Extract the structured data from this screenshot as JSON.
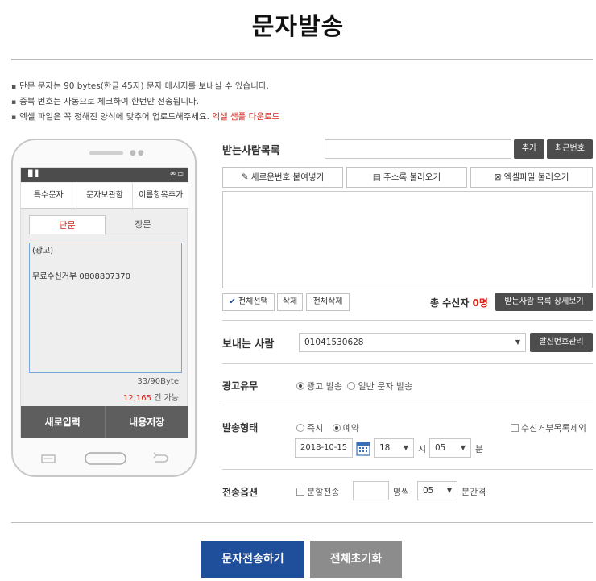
{
  "page": {
    "title": "문자발송"
  },
  "notes": [
    "단문 문자는 90 bytes(한글 45자) 문자 메시지를 보내실 수 있습니다.",
    "중복 번호는 자동으로 체크하여 한번만 전송됩니다.",
    "엑셀 파일은 꼭 정해진 양식에 맞추어 업로드해주세요."
  ],
  "excel_sample_link": "엑셀 샘플 다운로드",
  "phone": {
    "tabs": [
      "특수문자",
      "문자보관함",
      "이름항목추가"
    ],
    "subtabs": [
      "단문",
      "장문"
    ],
    "message": "(광고)\n\n무료수신거부 0808807370",
    "bytes": "33/90Byte",
    "avail_count": "12,165",
    "avail_suffix": " 건 가능",
    "btn_new": "새로입력",
    "btn_save": "내용저장"
  },
  "recipients": {
    "label": "받는사람목록",
    "input_value": "",
    "add": "추가",
    "recent": "최근번호",
    "paste": "새로운번호 붙여넣기",
    "address": "주소록 불러오기",
    "excel": "엑셀파일 불러오기",
    "select_all": "전체선택",
    "delete": "삭제",
    "delete_all": "전체삭제",
    "total_label": "총 수신자",
    "total_count": "0명",
    "detail": "받는사람 목록 상세보기"
  },
  "sender": {
    "label": "보내는 사람",
    "number": "01041530628",
    "manage": "발신번호관리"
  },
  "ad": {
    "label": "광고유무",
    "opt1": "광고 발송",
    "opt2": "일반 문자 발송"
  },
  "send_type": {
    "label": "발송형태",
    "opt1": "즉시",
    "opt2": "예약",
    "reject": "수신거부목록제외",
    "date": "2018-10-15",
    "hour": "18",
    "hour_unit": "시",
    "minute": "05",
    "minute_unit": "분"
  },
  "options": {
    "label": "전송옵션",
    "split": "분할전송",
    "per_label": "명씩",
    "interval": "05",
    "interval_label": "분간격",
    "count_value": ""
  },
  "buttons": {
    "send": "문자전송하기",
    "reset": "전체초기화"
  },
  "colors": {
    "primary": "#1f4e9b",
    "accent_red": "#d9261c",
    "dark_button": "#4d4d4d",
    "reset_button": "#8c8c8c"
  }
}
